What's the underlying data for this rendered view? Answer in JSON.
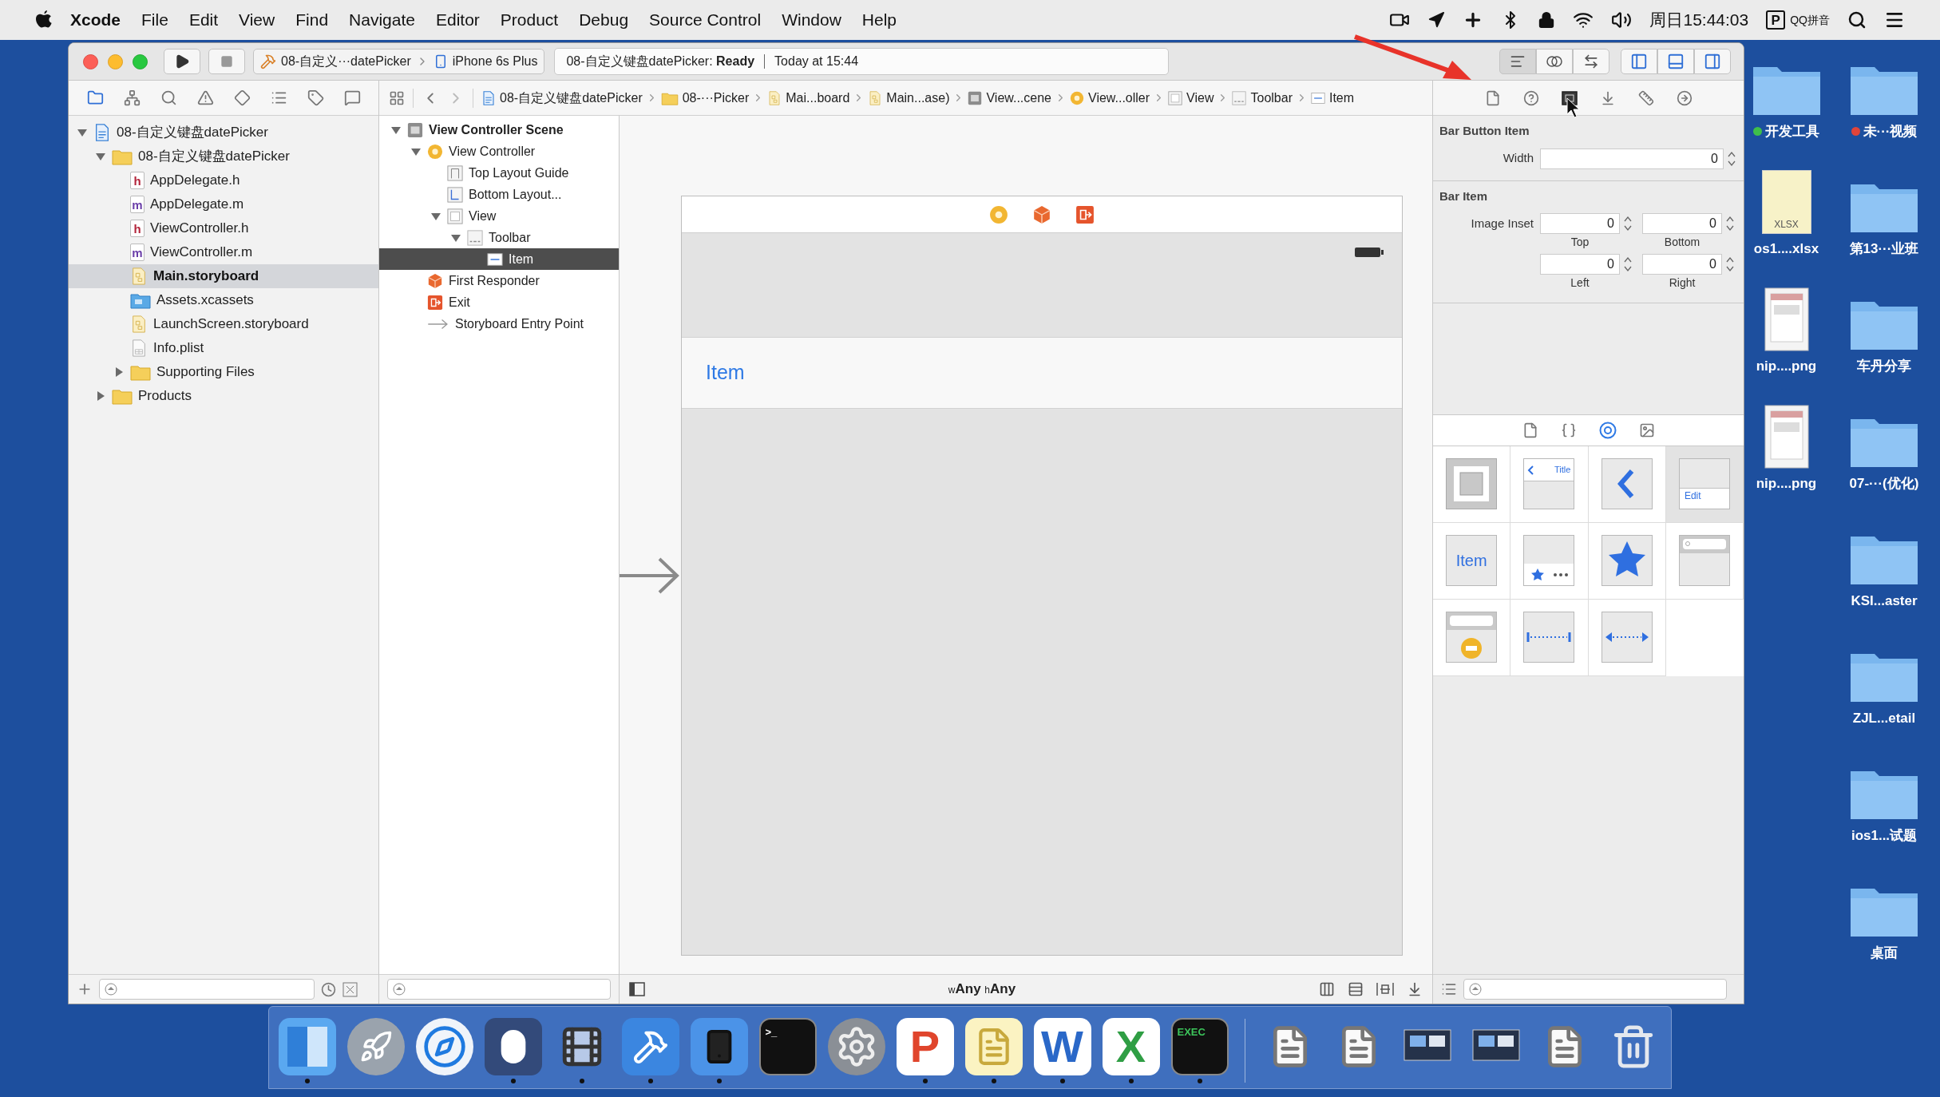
{
  "menubar": {
    "app": "Xcode",
    "menus": [
      "File",
      "Edit",
      "View",
      "Find",
      "Navigate",
      "Editor",
      "Product",
      "Debug",
      "Source Control",
      "Window",
      "Help"
    ],
    "clock": "周日15:44:03",
    "ime_glyph": "P",
    "ime": "QQ拼音"
  },
  "toolbar": {
    "scheme": "08-自定义···datePicker",
    "device": "iPhone 6s Plus",
    "activity": "08-自定义键盘datePicker: **Ready**",
    "time": "Today at 15:44",
    "editor_modes": [
      {
        "selected": true
      },
      {
        "selected": false
      },
      {
        "selected": false
      }
    ],
    "panels": [
      {
        "on": true
      },
      {
        "on": true
      },
      {
        "on": true
      }
    ]
  },
  "navigator": {
    "tabs": [
      {
        "selected": true
      },
      {
        "selected": false
      },
      {
        "selected": false
      },
      {
        "selected": false
      },
      {
        "selected": false
      },
      {
        "selected": false
      },
      {
        "selected": false
      },
      {
        "selected": false
      }
    ],
    "tree": [
      {
        "label": "08-自定义键盘datePicker",
        "kind": "project",
        "expanded": true,
        "selected": false,
        "children": [
          {
            "label": "08-自定义键盘datePicker",
            "kind": "group",
            "expanded": true,
            "selected": false,
            "children": [
              {
                "label": "AppDelegate.h",
                "kind": "header",
                "badge": "h",
                "selected": false
              },
              {
                "label": "AppDelegate.m",
                "kind": "source",
                "badge": "m",
                "selected": false
              },
              {
                "label": "ViewController.h",
                "kind": "header",
                "badge": "h",
                "selected": false
              },
              {
                "label": "ViewController.m",
                "kind": "source",
                "badge": "m",
                "selected": false
              },
              {
                "label": "Main.storyboard",
                "kind": "storyboard",
                "selected": true
              },
              {
                "label": "Assets.xcassets",
                "kind": "assets",
                "selected": false
              },
              {
                "label": "LaunchScreen.storyboard",
                "kind": "storyboard",
                "selected": false
              },
              {
                "label": "Info.plist",
                "kind": "plist",
                "selected": false
              },
              {
                "label": "Supporting Files",
                "kind": "group",
                "expanded": false,
                "selected": false
              }
            ]
          },
          {
            "label": "Products",
            "kind": "group",
            "expanded": false,
            "selected": false
          }
        ]
      }
    ]
  },
  "jump_bar": [
    {
      "label": "08-自定义键盘datePicker",
      "kind": "project"
    },
    {
      "label": "08-···Picker",
      "kind": "group"
    },
    {
      "label": "Mai...board",
      "kind": "storyboard"
    },
    {
      "label": "Main...ase)",
      "kind": "storyboard"
    },
    {
      "label": "View...cene",
      "kind": "scene"
    },
    {
      "label": "View...oller",
      "kind": "controller"
    },
    {
      "label": "View",
      "kind": "view"
    },
    {
      "label": "Toolbar",
      "kind": "toolbar"
    },
    {
      "label": "Item",
      "kind": "item"
    }
  ],
  "outline": [
    {
      "label": "View Controller Scene",
      "kind": "scene",
      "expanded": true,
      "selected": false,
      "children": [
        {
          "label": "View Controller",
          "kind": "controller",
          "expanded": true,
          "selected": false,
          "children": [
            {
              "label": "Top Layout Guide",
              "kind": "guide-top",
              "selected": false
            },
            {
              "label": "Bottom Layout...",
              "kind": "guide-bottom",
              "selected": false
            },
            {
              "label": "View",
              "kind": "view",
              "expanded": true,
              "selected": false,
              "children": [
                {
                  "label": "Toolbar",
                  "kind": "toolbar",
                  "expanded": true,
                  "selected": false,
                  "children": [
                    {
                      "label": "Item",
                      "kind": "item",
                      "selected": true
                    }
                  ]
                }
              ]
            }
          ]
        },
        {
          "label": "First Responder",
          "kind": "responder",
          "selected": false
        },
        {
          "label": "Exit",
          "kind": "exit",
          "selected": false
        },
        {
          "label": "Storyboard Entry Point",
          "kind": "entry",
          "selected": false
        }
      ]
    }
  ],
  "canvas": {
    "toolbar_item": "Item",
    "size_class": [
      {
        "prefix": "w",
        "value": "Any"
      },
      {
        "prefix": "h",
        "value": "Any"
      }
    ]
  },
  "inspector": {
    "tabs": [
      {
        "selected": false
      },
      {
        "selected": false
      },
      {
        "selected": true
      },
      {
        "selected": false
      },
      {
        "selected": false
      },
      {
        "selected": false
      }
    ],
    "sections": [
      {
        "title": "Bar Button Item",
        "kind": "single",
        "label": "Width",
        "fields": [
          {
            "value": "0"
          }
        ]
      },
      {
        "title": "Bar Item",
        "kind": "inset",
        "label": "Image Inset",
        "fields": [
          {
            "value": "0",
            "caption": "Top"
          },
          {
            "value": "0",
            "caption": "Bottom"
          },
          {
            "value": "0",
            "caption": "Left"
          },
          {
            "value": "0",
            "caption": "Right"
          }
        ]
      }
    ]
  },
  "library": {
    "tabs": [
      {
        "selected": false
      },
      {
        "selected": false
      },
      {
        "selected": true
      },
      {
        "selected": false
      }
    ],
    "tiles": [
      {
        "kind": "view-controller",
        "selected": false
      },
      {
        "kind": "navigation-bar",
        "text": "Title",
        "selected": false
      },
      {
        "kind": "back-chevron",
        "selected": false
      },
      {
        "kind": "table-edit",
        "text": "Edit",
        "selected": true
      },
      {
        "kind": "bar-button-item",
        "text": "Item",
        "selected": false
      },
      {
        "kind": "tab-bar",
        "selected": false
      },
      {
        "kind": "star",
        "selected": false
      },
      {
        "kind": "search-bar",
        "selected": false
      },
      {
        "kind": "search-display",
        "selected": false
      },
      {
        "kind": "fixed-space",
        "selected": false
      },
      {
        "kind": "flexible-space",
        "selected": false
      }
    ]
  },
  "desktop": {
    "left": [
      {
        "label": "开发工具",
        "kind": "folder",
        "color": "#3fbf4a"
      },
      {
        "label": "os1....xlsx",
        "kind": "xlsx",
        "glyph": "XLSX"
      },
      {
        "label": "nip....png",
        "kind": "png"
      },
      {
        "label": "nip....png",
        "kind": "png"
      }
    ],
    "right": [
      {
        "label": "未···视频",
        "kind": "folder",
        "color": "#e0443a"
      },
      {
        "label": "第13···业班",
        "kind": "folder"
      },
      {
        "label": "车丹分享",
        "kind": "folder"
      },
      {
        "label": "07-···(优化)",
        "kind": "folder"
      },
      {
        "label": "KSI...aster",
        "kind": "folder"
      },
      {
        "label": "ZJL...etail",
        "kind": "folder"
      },
      {
        "label": "ios1...试题",
        "kind": "folder"
      },
      {
        "label": "桌面",
        "kind": "folder"
      }
    ]
  },
  "dock": [
    {
      "kind": "finder",
      "running": true
    },
    {
      "kind": "launchpad",
      "running": false
    },
    {
      "kind": "safari",
      "running": false
    },
    {
      "kind": "mouse",
      "running": true
    },
    {
      "kind": "movie",
      "running": true
    },
    {
      "kind": "xcode",
      "running": true
    },
    {
      "kind": "simulator",
      "running": true
    },
    {
      "kind": "terminal",
      "glyph": ">_",
      "running": false
    },
    {
      "kind": "preferences",
      "running": false
    },
    {
      "kind": "powerpoint",
      "glyph": "P",
      "running": true
    },
    {
      "kind": "notes",
      "running": true
    },
    {
      "kind": "word",
      "glyph": "W",
      "running": true
    },
    {
      "kind": "excel",
      "glyph": "X",
      "running": true
    },
    {
      "kind": "exec",
      "glyph": "EXEC",
      "running": true
    },
    {
      "kind": "separator"
    },
    {
      "kind": "document"
    },
    {
      "kind": "document"
    },
    {
      "kind": "screenshot"
    },
    {
      "kind": "screenshot"
    },
    {
      "kind": "document"
    },
    {
      "kind": "trash"
    }
  ]
}
